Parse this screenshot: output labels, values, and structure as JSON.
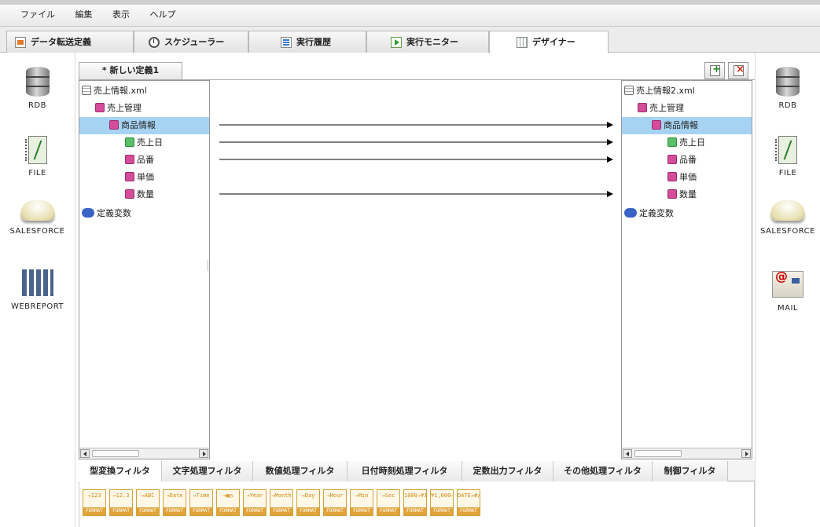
{
  "menu": [
    "ファイル",
    "編集",
    "表示",
    "ヘルプ"
  ],
  "tabs": [
    {
      "label": "データ転送定義",
      "icon": "document-icon"
    },
    {
      "label": "スケジューラー",
      "icon": "clock-icon"
    },
    {
      "label": "実行履歴",
      "icon": "history-icon"
    },
    {
      "label": "実行モニター",
      "icon": "monitor-play-icon"
    },
    {
      "label": "デザイナー",
      "icon": "designer-grid-icon",
      "active": true
    }
  ],
  "left_sources": [
    "RDB",
    "FILE",
    "SALESFORCE",
    "WEBREPORT"
  ],
  "right_targets": [
    "RDB",
    "FILE",
    "SALESFORCE",
    "MAIL"
  ],
  "definition_tab": "* 新しい定義1",
  "source_tree": {
    "root": "売上情報.xml",
    "nodes": [
      {
        "label": "売上管理",
        "type": "element",
        "depth": 1
      },
      {
        "label": "商品情報",
        "type": "element",
        "depth": 2,
        "selected": true
      },
      {
        "label": "売上日",
        "type": "attribute",
        "depth": 3
      },
      {
        "label": "品番",
        "type": "element",
        "depth": 3
      },
      {
        "label": "単価",
        "type": "element",
        "depth": 3
      },
      {
        "label": "数量",
        "type": "element",
        "depth": 3
      }
    ],
    "variables": "定義変数"
  },
  "target_tree": {
    "root": "売上情報2.xml",
    "nodes": [
      {
        "label": "売上管理",
        "type": "element",
        "depth": 1
      },
      {
        "label": "商品情報",
        "type": "element",
        "depth": 2,
        "selected": true
      },
      {
        "label": "売上日",
        "type": "attribute",
        "depth": 3
      },
      {
        "label": "品番",
        "type": "element",
        "depth": 3
      },
      {
        "label": "単価",
        "type": "element",
        "depth": 3
      },
      {
        "label": "数量",
        "type": "element",
        "depth": 3
      }
    ],
    "variables": "定義変数"
  },
  "mappings": [
    {
      "from": "商品情報",
      "to": "商品情報"
    },
    {
      "from": "売上日",
      "to": "売上日"
    },
    {
      "from": "品番",
      "to": "品番"
    },
    {
      "from": "数量",
      "to": "数量"
    }
  ],
  "filter_tabs": [
    "型変換フィルタ",
    "文字処理フィルタ",
    "数値処理フィルタ",
    "日付時刻処理フィルタ",
    "定数出力フィルタ",
    "その他処理フィルタ",
    "制御フィルタ"
  ],
  "filter_buttons": [
    {
      "top": "→123",
      "bottom": "FORMAT"
    },
    {
      "top": "→12.3",
      "bottom": "FORMAT"
    },
    {
      "top": "→ABC",
      "bottom": "FORMAT"
    },
    {
      "top": "→Date",
      "bottom": "FORMAT"
    },
    {
      "top": "→Time",
      "bottom": "FORMAT"
    },
    {
      "top": "→▦◷",
      "bottom": "FORMAT"
    },
    {
      "top": "→Year",
      "bottom": "FORMAT"
    },
    {
      "top": "→Month",
      "bottom": "FORMAT"
    },
    {
      "top": "→Day",
      "bottom": "FORMAT"
    },
    {
      "top": "→Hour",
      "bottom": "FORMAT"
    },
    {
      "top": "→Min",
      "bottom": "FORMAT"
    },
    {
      "top": "→Sec",
      "bottom": "FORMAT"
    },
    {
      "top": "1000→¥1,000",
      "bottom": "FORMAT"
    },
    {
      "top": "¥1,000→1000",
      "bottom": "FORMAT"
    },
    {
      "top": "DATE→#/#/#",
      "bottom": "FORMAT"
    }
  ]
}
